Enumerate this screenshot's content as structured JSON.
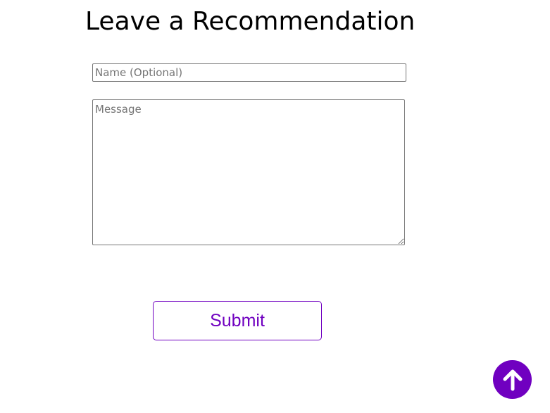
{
  "form": {
    "title": "Leave a Recommendation",
    "name_placeholder": "Name (Optional)",
    "name_value": "",
    "message_placeholder": "Message",
    "message_value": "",
    "submit_label": "Submit"
  },
  "scroll_top": {
    "icon": "arrow-up-icon"
  },
  "colors": {
    "accent": "#7000c0",
    "icon_fg": "#ffffff"
  }
}
